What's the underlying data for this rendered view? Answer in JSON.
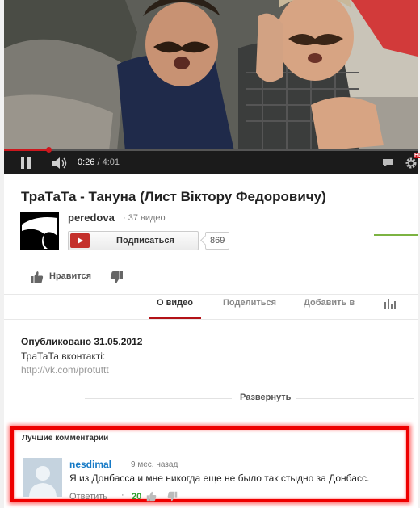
{
  "player": {
    "current_time": "0:26",
    "separator": "/",
    "duration": "4:01",
    "progress_fraction": 0.108,
    "hd_badge": "HD",
    "accent": "#cc181e"
  },
  "video": {
    "title": "ТраТаТа - Тануна (Лист Віктору Федоровичу)"
  },
  "channel": {
    "name": "peredova",
    "video_count": "· 37 видео",
    "subscribe_label": "Подписаться",
    "subscriber_count": "869"
  },
  "actions": {
    "like_label": "Нравится"
  },
  "tabs": [
    {
      "label": "О видео",
      "active": true
    },
    {
      "label": "Поделиться",
      "active": false
    },
    {
      "label": "Добавить в",
      "active": false
    }
  ],
  "description": {
    "published": "Опубликовано 31.05.2012",
    "line1": "ТраТаТа вконтакті:",
    "link": "http://vk.com/protuttt",
    "expand_label": "Развернуть"
  },
  "comments": {
    "heading": "Лучшие комментарии",
    "items": [
      {
        "author": "nesdimal",
        "time_ago": "9 мес. назад",
        "text": "Я из Донбасса и мне никогда еще не было так стыдно за Донбасс.",
        "reply_label": "Ответить",
        "separator": "·",
        "likes": "20"
      }
    ]
  },
  "icons": {
    "pause": "pause-icon",
    "volume": "volume-icon",
    "captions": "captions-icon",
    "settings": "gear-icon",
    "like": "thumbs-up-icon",
    "dislike": "thumbs-down-icon",
    "stats": "stats-icon"
  }
}
